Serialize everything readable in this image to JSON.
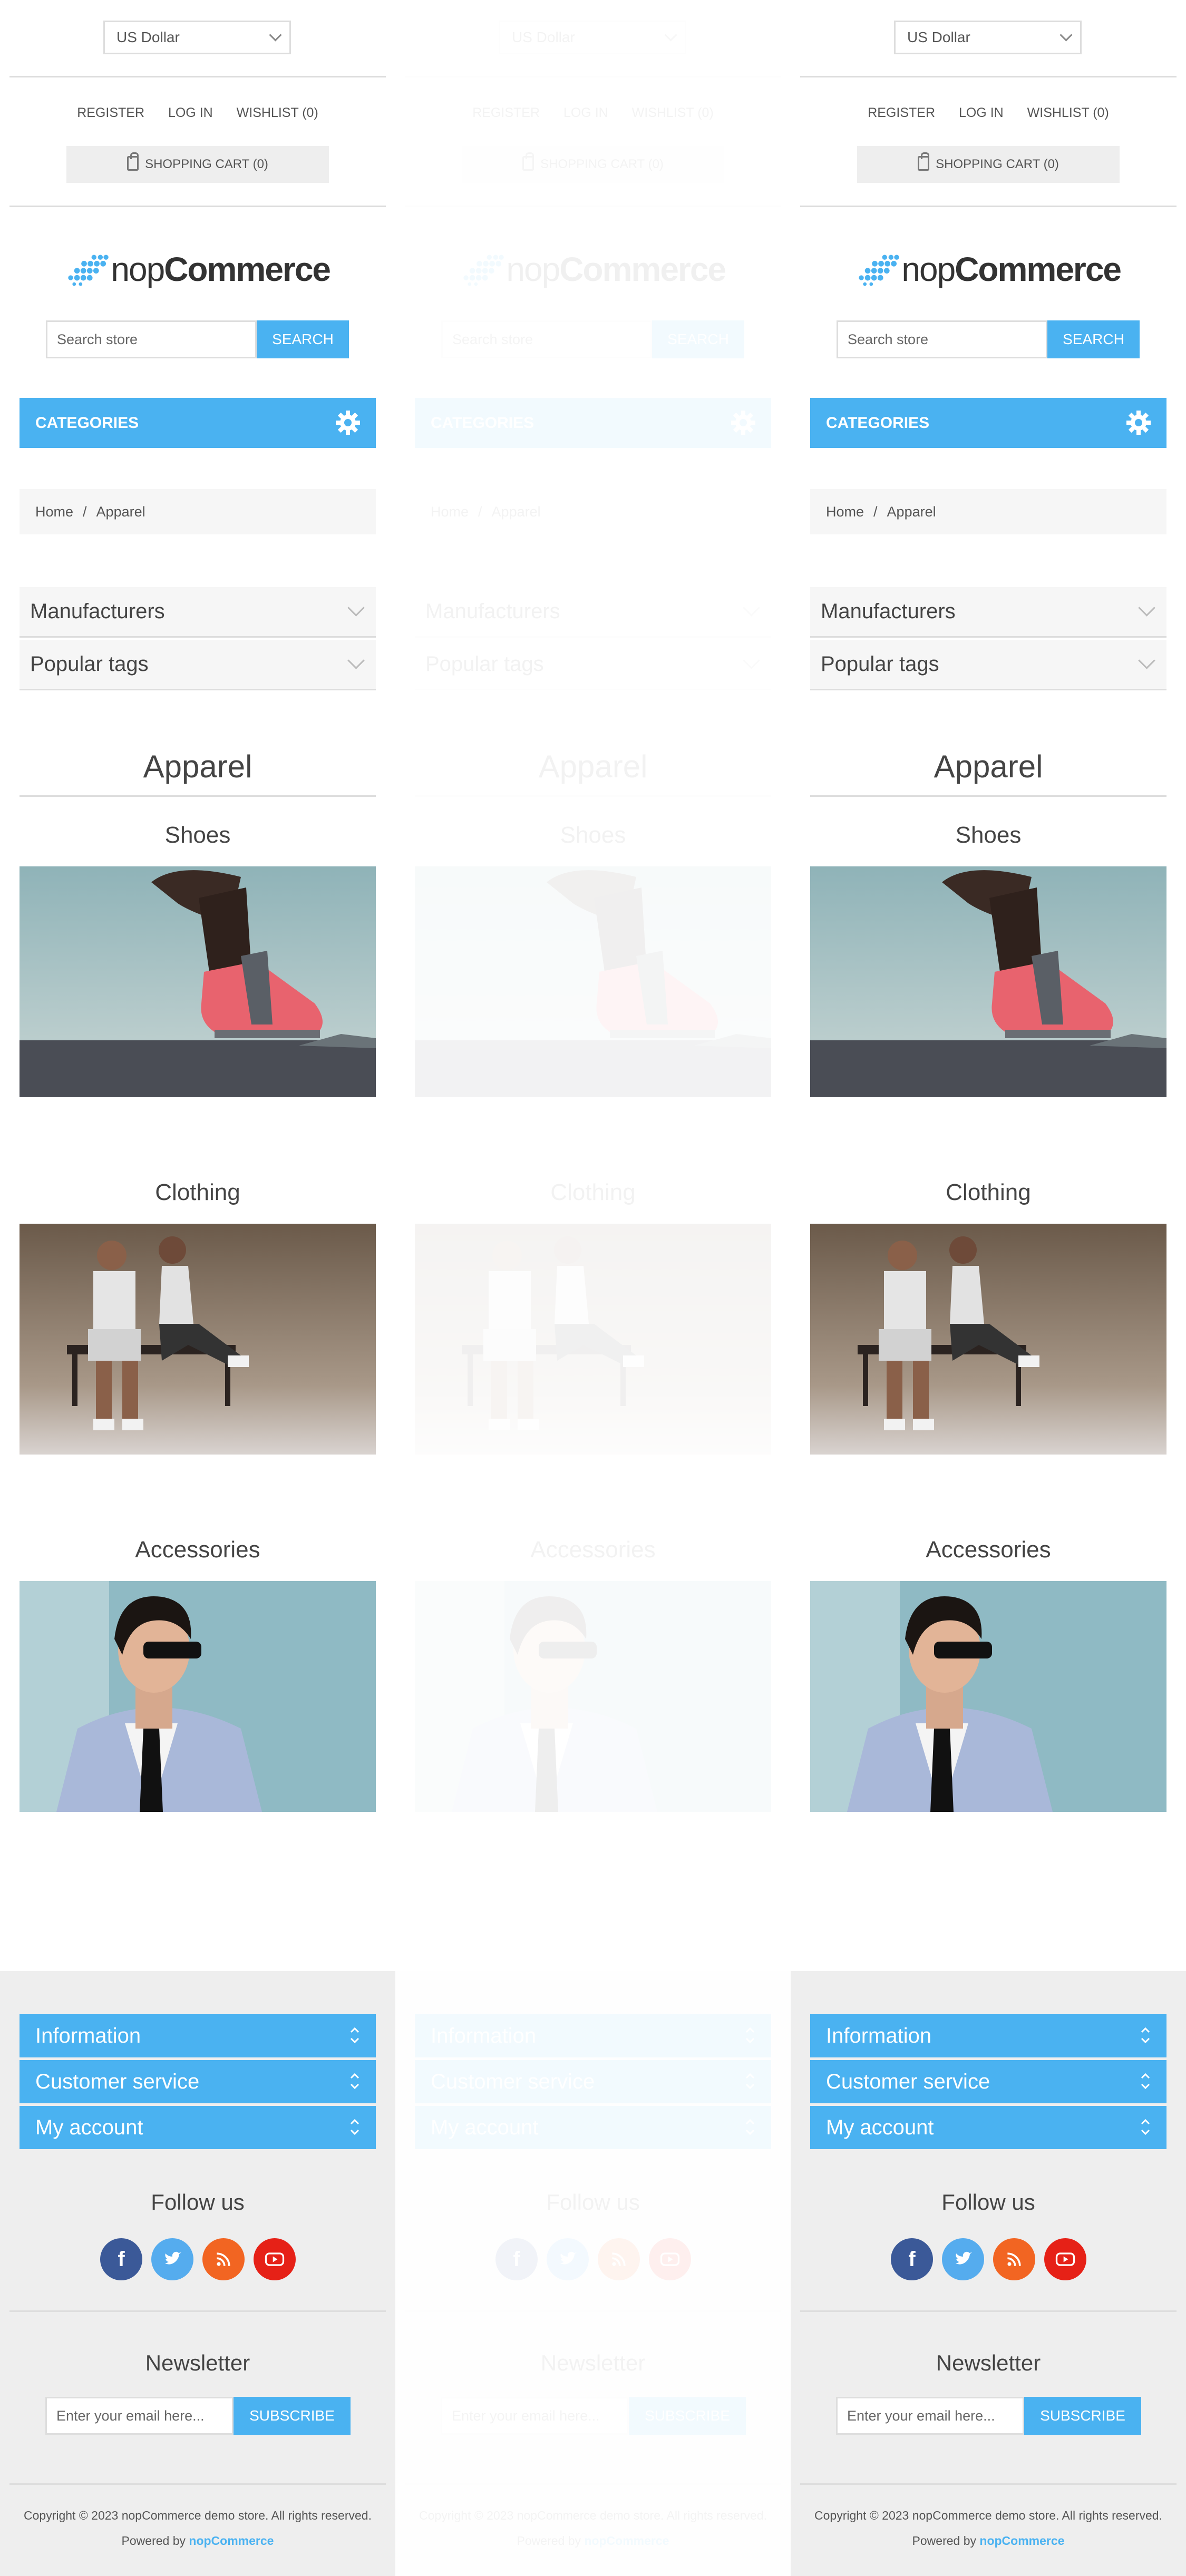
{
  "header": {
    "currency": "US Dollar",
    "links": {
      "register": "REGISTER",
      "login": "LOG IN",
      "wishlist": "WISHLIST (0)"
    },
    "cart": "SHOPPING CART (0)"
  },
  "logo": {
    "prefix": "nop",
    "suffix": "Commerce"
  },
  "search": {
    "placeholder": "Search store",
    "button": "SEARCH"
  },
  "categories_label": "CATEGORIES",
  "breadcrumb": {
    "home": "Home",
    "separator": "/",
    "current": "Apparel"
  },
  "side_blocks": [
    "Manufacturers",
    "Popular tags"
  ],
  "page_title": "Apparel",
  "subcategories": [
    "Shoes",
    "Clothing",
    "Accessories"
  ],
  "footer": {
    "accordions": [
      "Information",
      "Customer service",
      "My account"
    ],
    "follow_title": "Follow us",
    "social": [
      "facebook-icon",
      "twitter-icon",
      "rss-icon",
      "youtube-icon"
    ],
    "newsletter_title": "Newsletter",
    "newsletter_placeholder": "Enter your email here...",
    "newsletter_button": "SUBSCRIBE",
    "copyright": "Copyright © 2023 nopCommerce demo store. All rights reserved.",
    "powered_prefix": "Powered by",
    "powered_brand": "nopCommerce"
  },
  "colors": {
    "accent": "#4ab2f1",
    "footer_bg": "#eeeeee",
    "block_bg": "#f6f6f6"
  }
}
